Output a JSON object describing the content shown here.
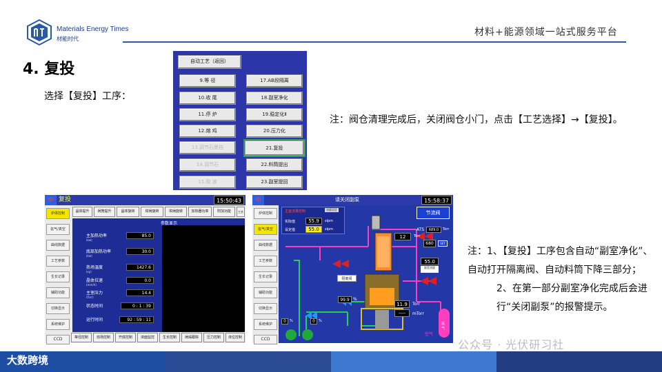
{
  "header": {
    "brand_en": "Materials Energy Times",
    "brand_cn": "材能时代",
    "slogan": "材料+能源领域一站式服务平台"
  },
  "section_title": "4. 复投",
  "instruction": "选择【复投】工序：",
  "note1": "注：阀仓清理完成后，关闭阀仓小门，点击【工艺选择】→【复投】。",
  "note2": {
    "line1": "注：1、【复投】工序包含自动“副室净化”、自动打开隔离阀、自动料筒下降三部分；",
    "line2": "2、在第一部分副室净化完成后会进行“关闭副泵”的报警提示。"
  },
  "process_menu": {
    "back": "自动工艺（返回）",
    "left": [
      "9.等 径",
      "10.收 尾",
      "11.停 炉",
      "12.熔 鸡",
      "13.调节石墨挡",
      "14.调节石",
      "15.取 液"
    ],
    "left_disabled": [
      false,
      false,
      false,
      false,
      true,
      true,
      true
    ],
    "right": [
      "17.AB段隔离",
      "18.副室净化",
      "19.稳定化Ⅱ",
      "20.压力化",
      "21.复投",
      "22.料筒提出",
      "23.副室提回"
    ],
    "selected": "21.复投"
  },
  "screen1": {
    "zh": "中",
    "title": "复投",
    "time": "15:50:43",
    "top_buttons": [
      "晶体提升",
      "埚筒提升",
      "晶体旋转",
      "坩埚旋转",
      "坩埚旋转",
      "加热器功率",
      "附加功能",
      "工艺选择"
    ],
    "side_buttons": [
      "炉体控制",
      "氩气/真空",
      "曲线数据",
      "工艺参数",
      "生长记录",
      "辅助功能",
      "切换显示",
      "系统维护",
      "CCD"
    ],
    "params_header": "参数显示",
    "params": [
      {
        "label": "主加热功率",
        "unit": "(kw)",
        "value": "85.0"
      },
      {
        "label": "底部加热功率",
        "unit": "(kw)",
        "value": "30.0"
      },
      {
        "label": "热场温度",
        "unit": "(sp)",
        "value": "1427.6"
      },
      {
        "label": "晶体拉速",
        "unit": "(mm/h)",
        "value": "0.0"
      },
      {
        "label": "主室压力",
        "unit": "(Torr)",
        "value": "14.4"
      },
      {
        "label": "状态时间",
        "unit": "",
        "value": "0 : 1 : 39"
      },
      {
        "label": "运行时间",
        "unit": "",
        "value": "92 : 59 : 11"
      }
    ],
    "bottom_buttons": [
      "等径控制",
      "熔场控制",
      "开底控制",
      "液面监控",
      "生长控制",
      "埚塌跟踪",
      "压力控制",
      "液位控制"
    ]
  },
  "screen2": {
    "zh": "中",
    "title": "请关闭副泵",
    "time": "15:58:37",
    "side_buttons": [
      "炉体控制",
      "氩气/真空",
      "曲线数据",
      "工艺参数",
      "生长记录",
      "辅助功能",
      "切换显示",
      "系统维护",
      "CCD"
    ],
    "argon_title": "主室流量控制",
    "argon_badge": "流量设定",
    "actual_label": "实际值",
    "actual_value": "55.9",
    "set_label": "设定值",
    "set_value": "55.0",
    "unit_slpm": "slpm",
    "throttle_button": "节流阀",
    "ats_label": "ATS",
    "ats_value": "689.0",
    "ats_unit": "Torr",
    "pressure_12": "12",
    "pressure_12_unit": "Torr",
    "value_680": "680",
    "set_button": "SET",
    "value_55": "55.0",
    "side_flow_label": "副室流量",
    "isolation_label": "隔离阀",
    "valve_pct": "99.9",
    "pct_unit": "%",
    "value_11_9": "11.9",
    "torr_unit": "Torr",
    "dashes": "----",
    "mtorr_unit": "mTorr",
    "air_label": "空气",
    "argon_tank_label": "氩气",
    "zero_a": "0",
    "zero_b": "0",
    "pct_a": "%",
    "pct_b": "%"
  },
  "footer": {
    "brand": "大数跨境",
    "watermark": "公众号 · 光伏研习社"
  }
}
